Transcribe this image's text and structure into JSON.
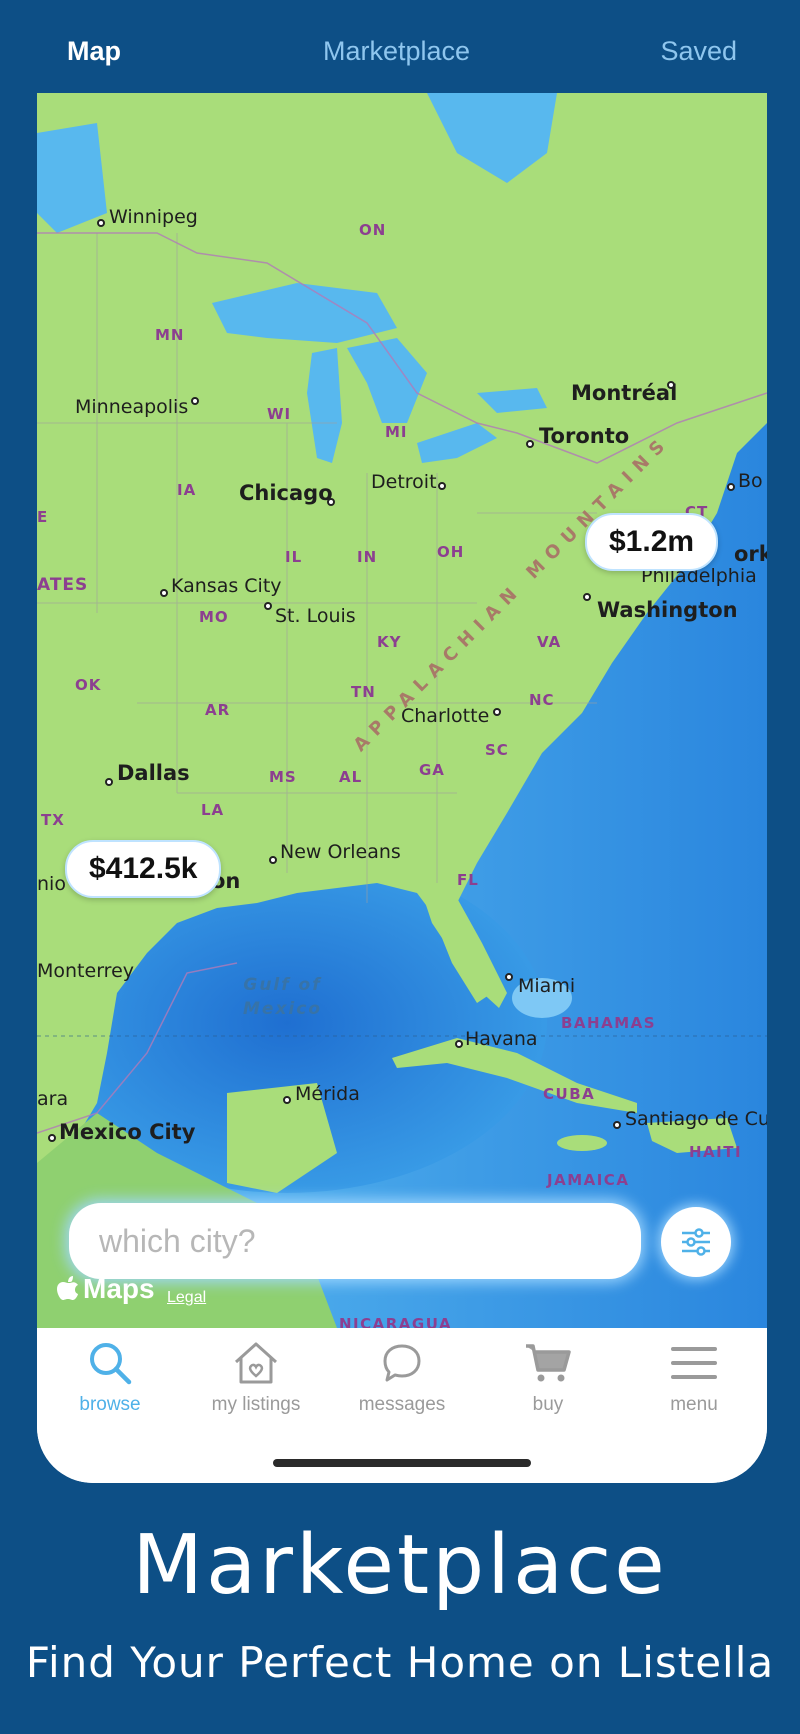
{
  "topbar": {
    "tabs": [
      {
        "label": "Map",
        "active": true
      },
      {
        "label": "Marketplace",
        "active": false
      },
      {
        "label": "Saved",
        "active": false
      }
    ]
  },
  "map": {
    "cities": {
      "winnipeg": "Winnipeg",
      "minneapolis": "Minneapolis",
      "chicago": "Chicago",
      "detroit": "Detroit",
      "toronto": "Toronto",
      "montreal": "Montréal",
      "boston": "Bo",
      "new_york": "ork",
      "philadelphia": "Philadelphia",
      "washington": "Washington",
      "kansas_city": "Kansas City",
      "st_louis": "St. Louis",
      "charlotte": "Charlotte",
      "dallas": "Dallas",
      "houston": "on",
      "san_antonio": "nio",
      "new_orleans": "New Orleans",
      "miami": "Miami",
      "havana": "Havana",
      "monterrey": "Monterrey",
      "merida": "Mérida",
      "mexico_city": "Mexico City",
      "santiago": "Santiago de Cu",
      "torreon": "ara"
    },
    "states": {
      "on": "ON",
      "mn": "MN",
      "wi": "WI",
      "mi": "MI",
      "ia": "IA",
      "il": "IL",
      "in": "IN",
      "oh": "OH",
      "mo": "MO",
      "ky": "KY",
      "va": "VA",
      "ok": "OK",
      "ar": "AR",
      "tn": "TN",
      "nc": "NC",
      "sc": "SC",
      "ms": "MS",
      "al": "AL",
      "ga": "GA",
      "la": "LA",
      "tx": "TX",
      "fl": "FL",
      "ct": "CT",
      "e": "E",
      "ates": "ATES"
    },
    "countries": {
      "bahamas": "BAHAMAS",
      "cuba": "CUBA",
      "haiti": "HAITI",
      "jamaica": "JAMAICA",
      "nicaragua": "NICARAGUA"
    },
    "sea": {
      "line1": "Gulf of",
      "line2": "Mexico"
    },
    "range": "APPALACHIAN MOUNTAINS",
    "pins": [
      {
        "label": "$1.2m"
      },
      {
        "label": "$412.5k"
      }
    ],
    "attribution": {
      "logo": "Maps",
      "legal": "Legal"
    },
    "colors": {
      "land": "#a9dd7a",
      "water": "#3d9ee8"
    }
  },
  "search": {
    "placeholder": "which city?",
    "value": ""
  },
  "tabbar": {
    "items": [
      {
        "label": "browse",
        "icon": "search-icon",
        "active": true
      },
      {
        "label": "my listings",
        "icon": "house-heart-icon",
        "active": false
      },
      {
        "label": "messages",
        "icon": "chat-bubble-icon",
        "active": false
      },
      {
        "label": "buy",
        "icon": "cart-icon",
        "active": false
      },
      {
        "label": "menu",
        "icon": "hamburger-icon",
        "active": false
      }
    ]
  },
  "promo": {
    "title": "Marketplace",
    "subtitle": "Find Your Perfect Home on Listella"
  }
}
